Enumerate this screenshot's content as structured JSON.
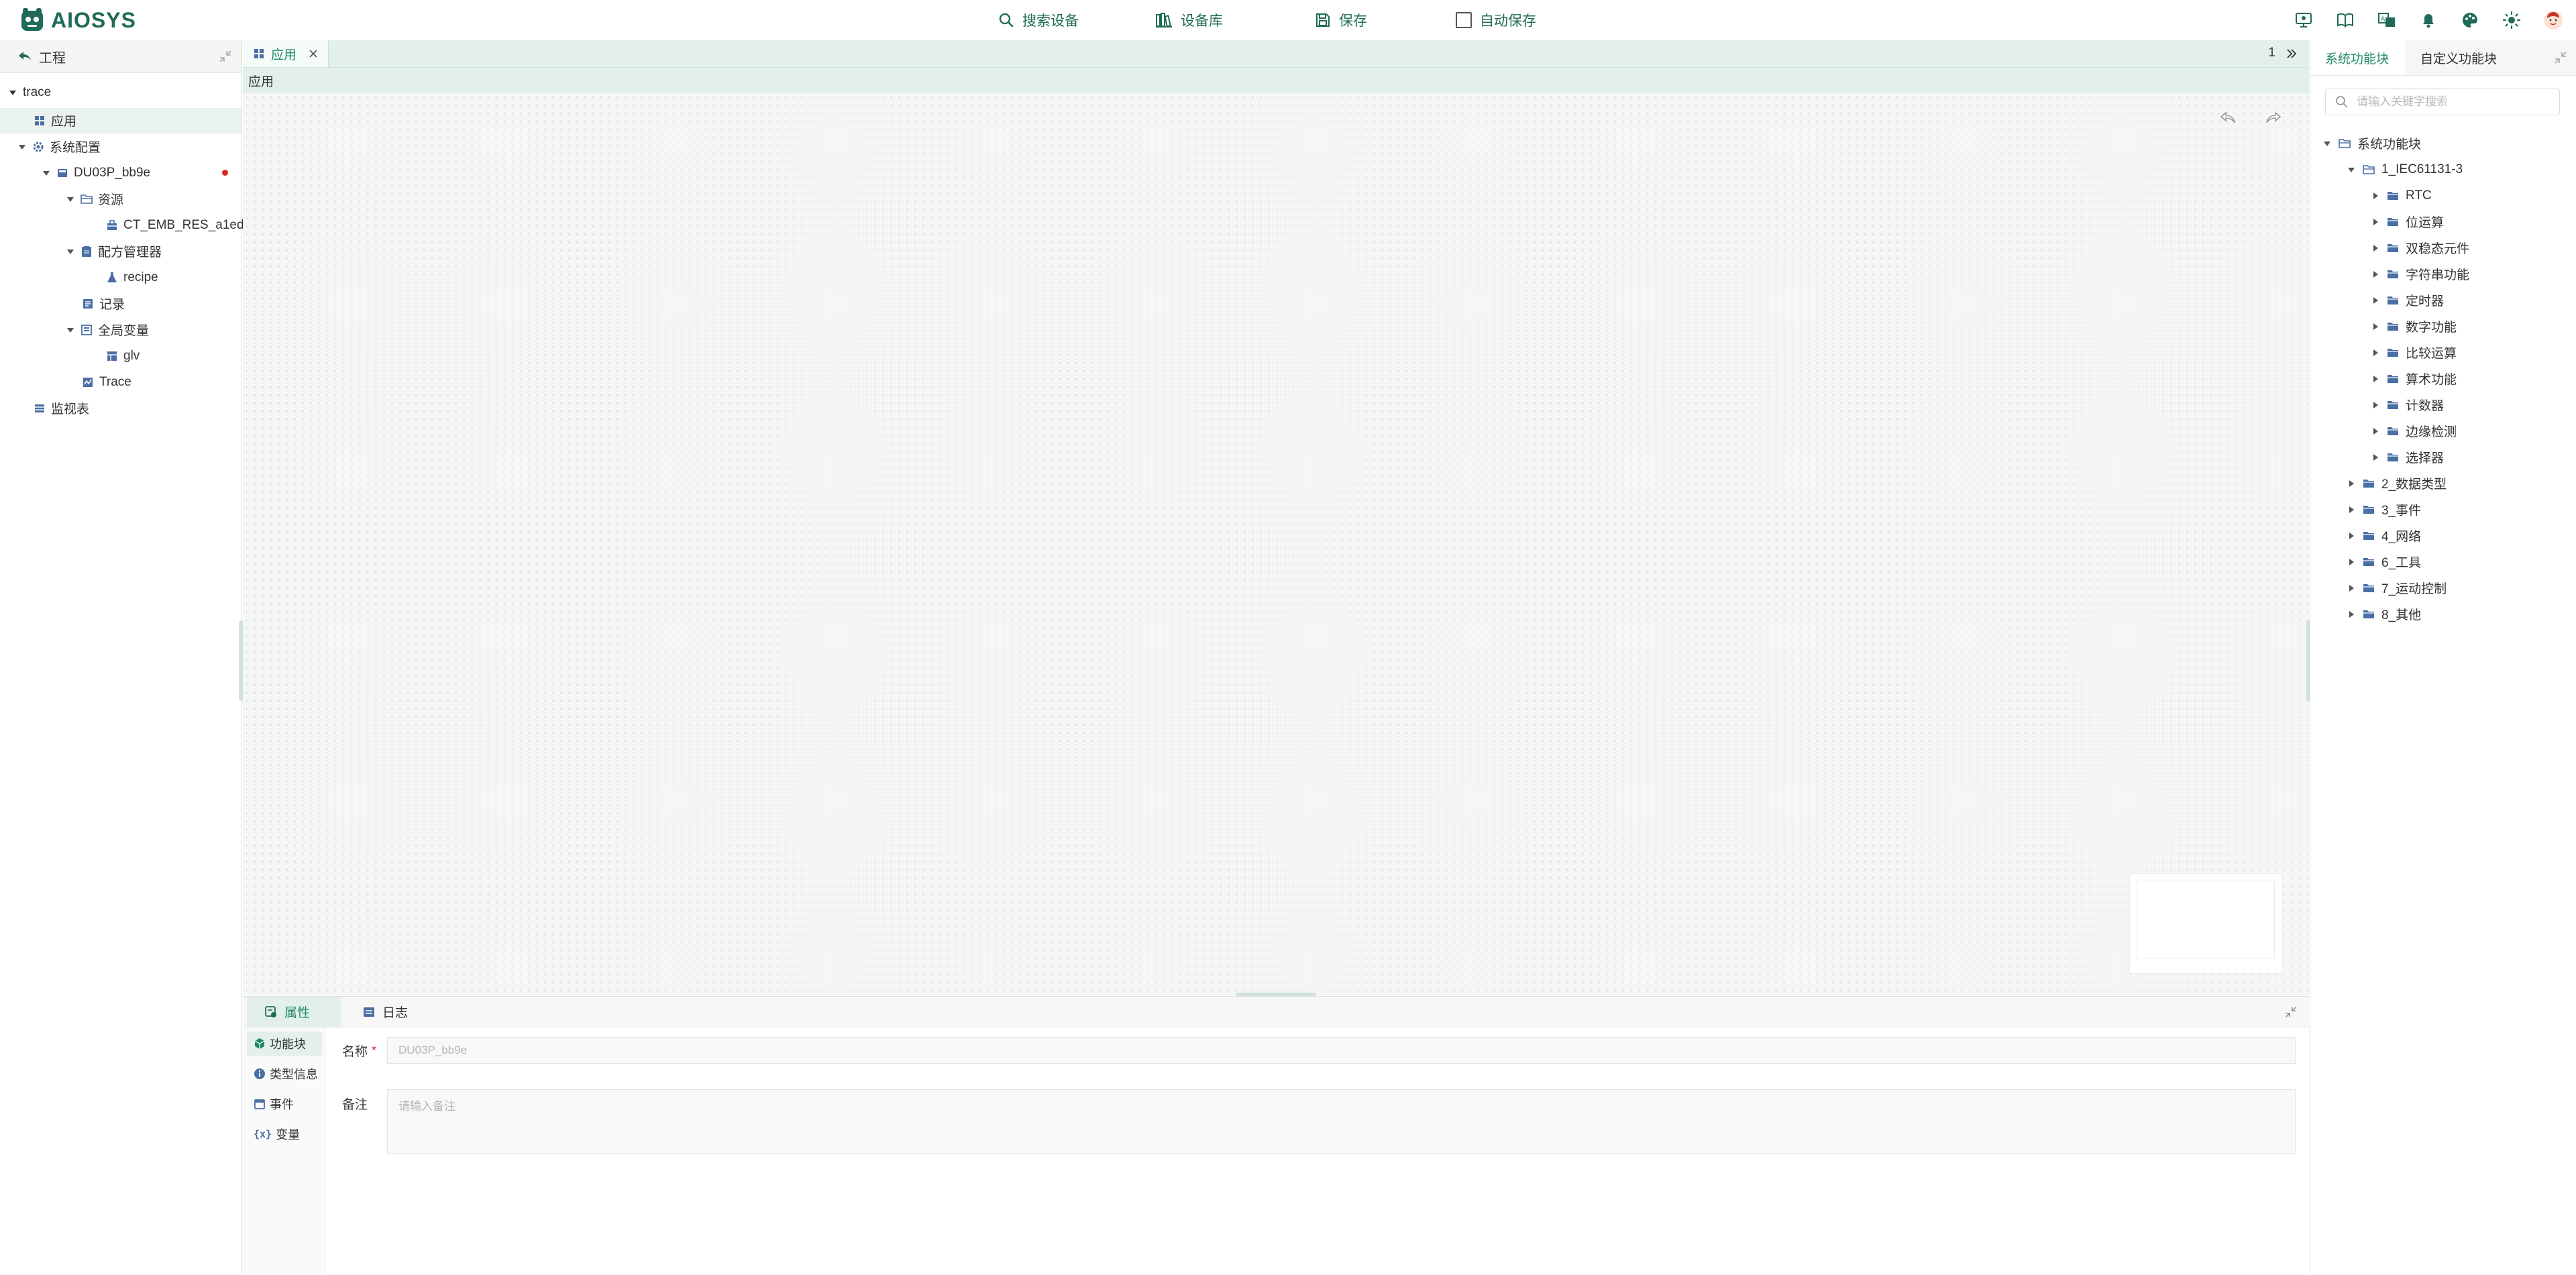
{
  "app": {
    "logo_text": "AIOSYS"
  },
  "toolbar": {
    "search_device": "搜索设备",
    "device_library": "设备库",
    "save": "保存",
    "autosave": "自动保存",
    "autosave_checked": false
  },
  "left_panel": {
    "title": "工程",
    "tree": {
      "root": "trace",
      "app": "应用",
      "sys_config": "系统配置",
      "device": "DU03P_bb9e",
      "resources": "资源",
      "resource_item": "CT_EMB_RES_a1ed",
      "recipe_manager": "配方管理器",
      "recipe": "recipe",
      "record": "记录",
      "global_vars": "全局变量",
      "glv": "glv",
      "trace": "Trace",
      "watch_table": "监视表"
    }
  },
  "editor": {
    "tab_label": "应用",
    "breadcrumb": "应用",
    "tab_count": "1"
  },
  "bottom_panel": {
    "tabs": {
      "properties": "属性",
      "log": "日志"
    },
    "side_tabs": {
      "function_block": "功能块",
      "type_info": "类型信息",
      "event": "事件",
      "variable": "变量"
    },
    "name_label": "名称",
    "required_mark": "*",
    "name_value": "DU03P_bb9e",
    "remark_label": "备注",
    "remark_placeholder": "请输入备注"
  },
  "right_panel": {
    "tabs": {
      "system": "系统功能块",
      "custom": "自定义功能块"
    },
    "search_placeholder": "请输入关键字搜索",
    "tree": {
      "root": "系统功能块",
      "iec": "1_IEC61131-3",
      "iec_children": [
        "RTC",
        "位运算",
        "双稳态元件",
        "字符串功能",
        "定时器",
        "数字功能",
        "比较运算",
        "算术功能",
        "计数器",
        "边缘检测",
        "选择器"
      ],
      "groups": [
        "2_数据类型",
        "3_事件",
        "4_网络",
        "6_工具",
        "7_运动控制",
        "8_其他"
      ]
    }
  },
  "colors": {
    "accent": "#1f8a6a",
    "brand": "#1f6b57",
    "tab_bg": "#e3f0ea",
    "canvas_bg": "#f5f6f6",
    "modified_dot": "#e02020"
  }
}
